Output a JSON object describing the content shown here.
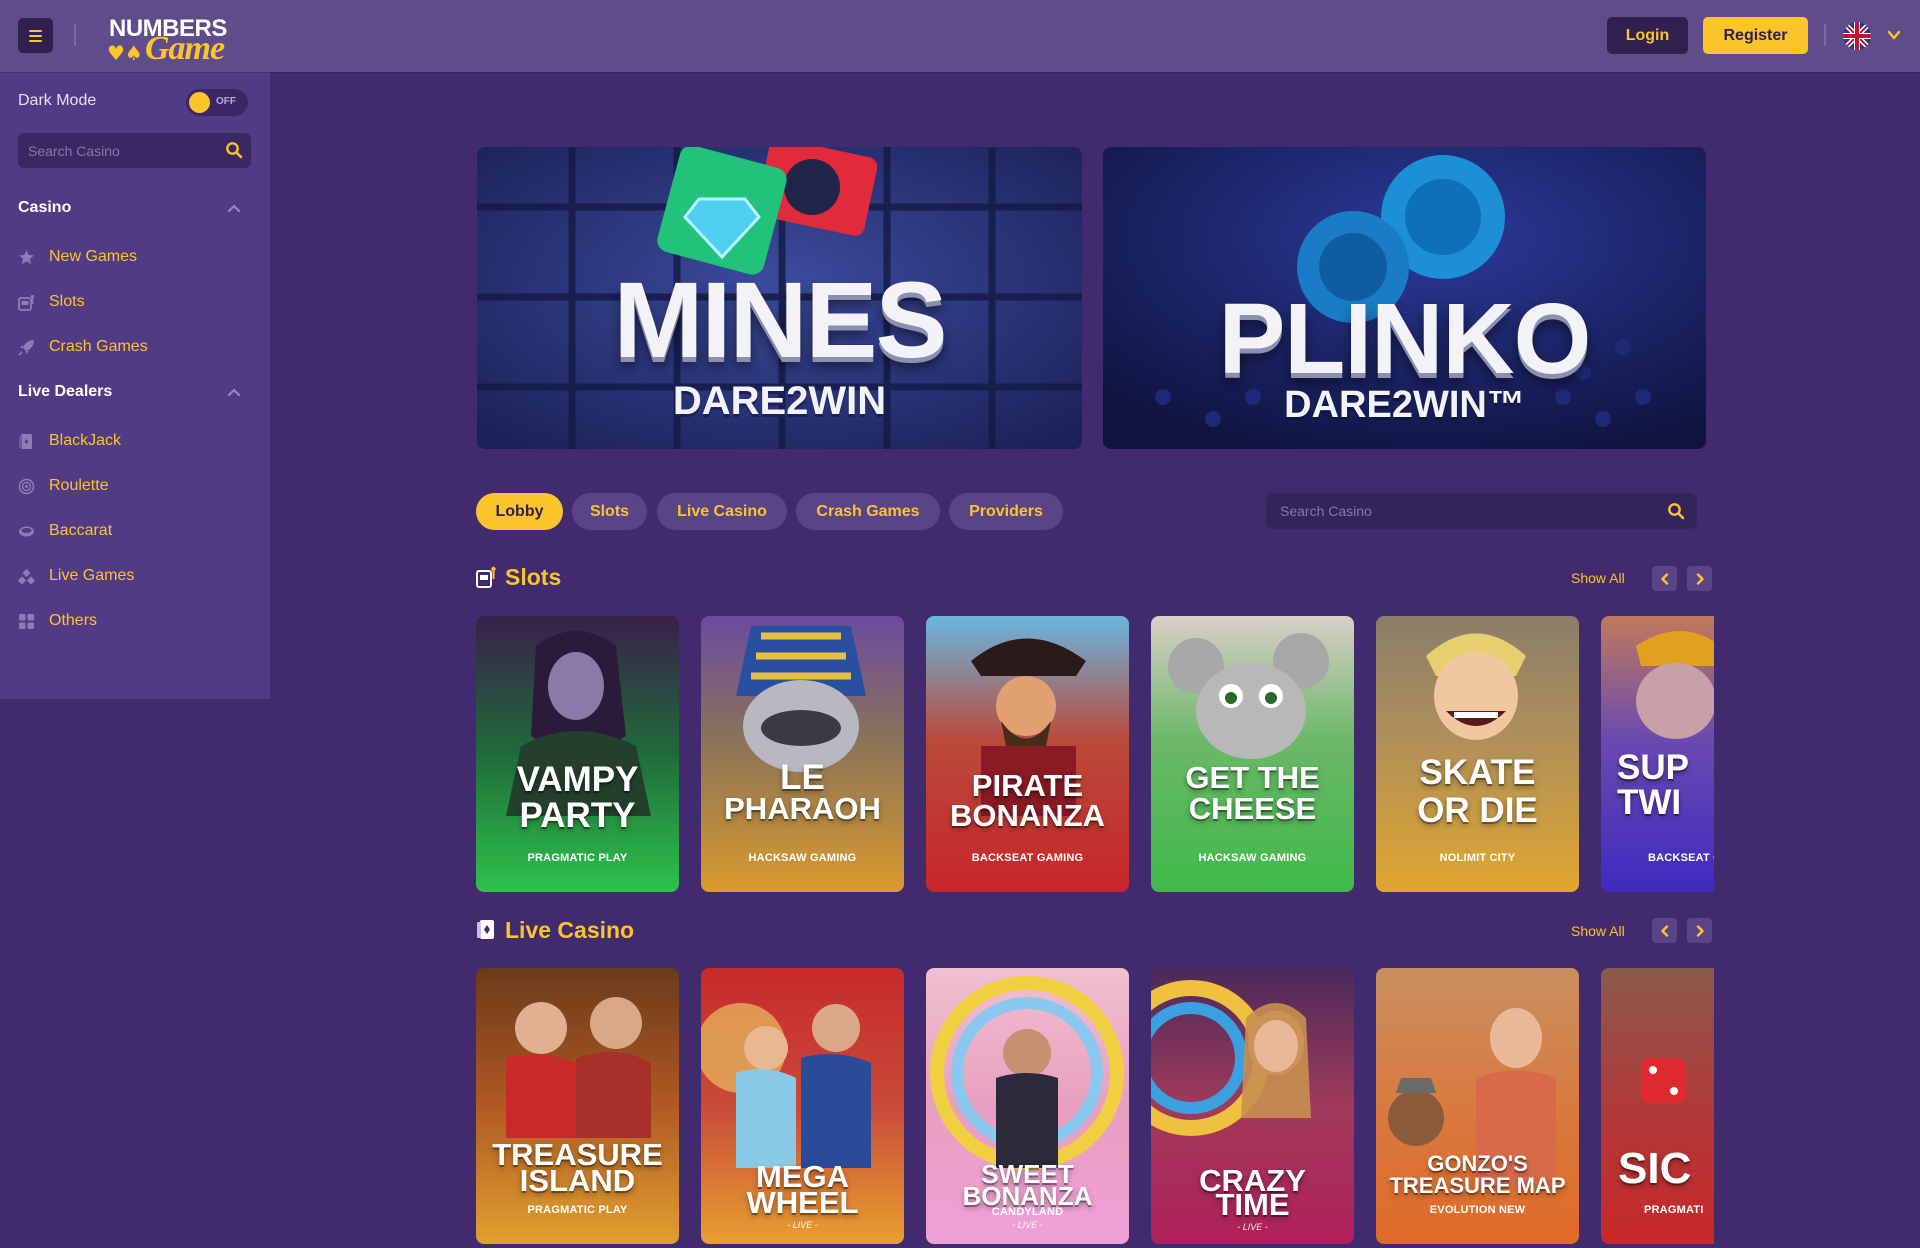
{
  "header": {
    "logo_top": "NUMBERS",
    "logo_bottom": "Game",
    "login_label": "Login",
    "register_label": "Register",
    "language": "English (UK)"
  },
  "sidebar": {
    "dark_mode_label": "Dark Mode",
    "dark_mode_state": "OFF",
    "search_placeholder": "Search Casino",
    "casino": {
      "title": "Casino",
      "items": [
        {
          "label": "New Games",
          "icon": "star-icon"
        },
        {
          "label": "Slots",
          "icon": "slot-machine-icon"
        },
        {
          "label": "Crash Games",
          "icon": "rocket-icon"
        }
      ]
    },
    "live_dealers": {
      "title": "Live Dealers",
      "items": [
        {
          "label": "BlackJack",
          "icon": "cards-icon"
        },
        {
          "label": "Roulette",
          "icon": "roulette-icon"
        },
        {
          "label": "Baccarat",
          "icon": "baccarat-icon"
        },
        {
          "label": "Live Games",
          "icon": "dice-icon"
        },
        {
          "label": "Others",
          "icon": "grid-icon"
        }
      ]
    }
  },
  "banners": [
    {
      "title": "MINES",
      "subtitle": "DARE2WIN"
    },
    {
      "title": "PLINKO",
      "subtitle": "DARE2WIN™"
    }
  ],
  "tabs": [
    "Lobby",
    "Slots",
    "Live Casino",
    "Crash Games",
    "Providers"
  ],
  "main_search_placeholder": "Search Casino",
  "slots": {
    "title": "Slots",
    "show_all": "Show All",
    "games": [
      {
        "title1": "VAMPY",
        "title2": "PARTY",
        "provider": "PRAGMATIC PLAY"
      },
      {
        "title1": "LE",
        "title2": "PHARAOH",
        "provider": "HACKSAW GAMING"
      },
      {
        "title1": "PIRATE",
        "title2": "BONANZA",
        "provider": "BACKSEAT GAMING"
      },
      {
        "title1": "GET THE",
        "title2": "CHEESE",
        "provider": "HACKSAW GAMING"
      },
      {
        "title1": "SKATE",
        "title2": "OR DIE",
        "provider": "NOLIMIT CITY"
      },
      {
        "title1": "SUP",
        "title2": "TWI",
        "provider": "BACKSEAT G"
      }
    ]
  },
  "live_casino": {
    "title": "Live Casino",
    "show_all": "Show All",
    "games": [
      {
        "title1": "TREASURE",
        "title2": "ISLAND",
        "sub": "",
        "provider": "PRAGMATIC PLAY"
      },
      {
        "title1": "MEGA",
        "title2": "WHEEL",
        "sub": "- LIVE -",
        "provider": ""
      },
      {
        "title1": "SWEET",
        "title2": "BONANZA",
        "sub": "CANDYLAND",
        "provider": "- LIVE -"
      },
      {
        "title1": "CRAZY",
        "title2": "TIME",
        "sub": "- LIVE -",
        "provider": ""
      },
      {
        "title1": "GONZO'S",
        "title2": "TREASURE MAP",
        "sub": "",
        "provider": "EVOLUTION NEW"
      },
      {
        "title1": "SIC",
        "title2": "",
        "sub": "",
        "provider": "PRAGMATI"
      }
    ]
  },
  "colors": {
    "accent": "#fcc42b",
    "background": "#422a6e",
    "topbar": "#5f4c8b",
    "sidebar": "#523b85"
  }
}
